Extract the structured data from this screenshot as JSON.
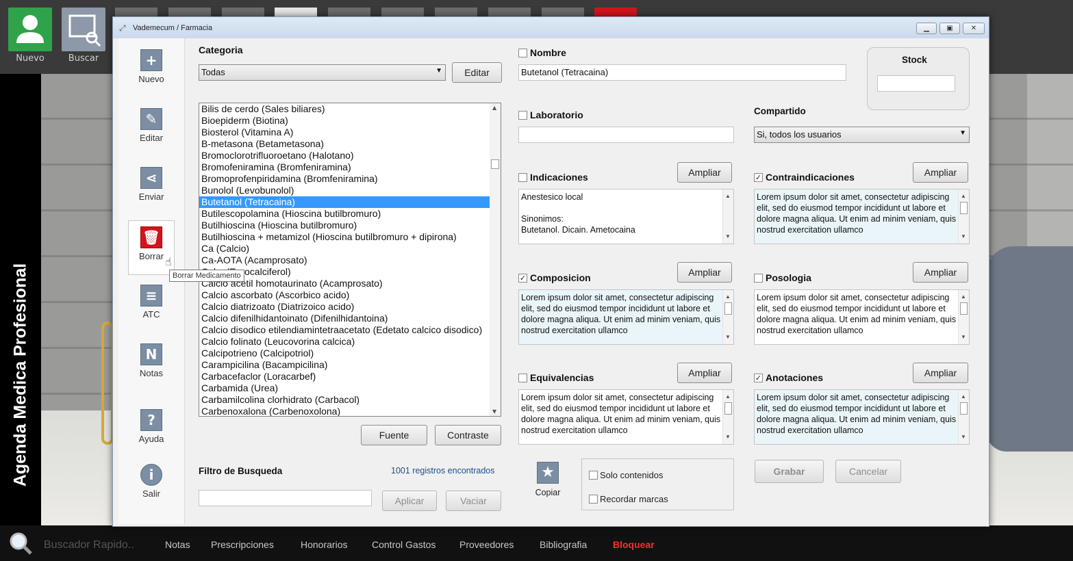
{
  "app": {
    "vertical_title": "Agenda Medica Profesional",
    "top_buttons": [
      {
        "label": "Nuevo"
      },
      {
        "label": "Buscar"
      }
    ],
    "taskbar": {
      "search_placeholder": "Buscador Rapido..",
      "links": [
        "Notas",
        "Prescripciones",
        "Honorarios",
        "Control Gastos",
        "Proveedores",
        "Bibliografia",
        "Bloquear"
      ]
    },
    "colors": {
      "accent": "#3399ff",
      "danger": "#d3141c",
      "nuevo_green": "#2fa34a",
      "bloquear_red": "#ff2b2b"
    }
  },
  "window": {
    "title": "Vademecum / Farmacia",
    "controls": [
      "minimize-icon",
      "maximize-icon",
      "close-icon"
    ]
  },
  "toolbar": {
    "items": [
      {
        "label": "Nuevo",
        "icon": "plus-icon"
      },
      {
        "label": "Editar",
        "icon": "edit-icon"
      },
      {
        "label": "Enviar",
        "icon": "share-icon"
      },
      {
        "label": "Borrar",
        "icon": "trash-icon"
      },
      {
        "label": "ATC",
        "icon": "printer-icon"
      },
      {
        "label": "Notas",
        "icon": "notes-icon"
      },
      {
        "label": "Ayuda",
        "icon": "question-icon"
      },
      {
        "label": "Salir",
        "icon": "exit-icon"
      }
    ],
    "tooltip": "Borrar Medicamento"
  },
  "categoria": {
    "label": "Categoria",
    "value": "Todas",
    "edit_label": "Editar"
  },
  "list": {
    "items": [
      "Bilis de cerdo (Sales biliares)",
      "Bioepiderm (Biotina)",
      "Biosterol (Vitamina A)",
      "B-metasona (Betametasona)",
      "Bromoclorotrifluoroetano (Halotano)",
      "Bromofeniramina (Bromfeniramina)",
      "Bromoprofenpiridamina (Bromfeniramina)",
      "Bunolol (Levobunolol)",
      "Butetanol (Tetracaina)",
      "Butilescopolamina (Hioscina butilbromuro)",
      "Butilhioscina (Hioscina butilbromuro)",
      "Butilhioscina + metamizol (Hioscina butilbromuro + dipirona)",
      "Ca (Calcio)",
      "Ca-AOTA (Acamprosato)",
      "Cal... (Ergocalciferol)",
      "Calcio acetil homotaurinato (Acamprosato)",
      "Calcio ascorbato (Ascorbico acido)",
      "Calcio diatrizoato (Diatrizoico acido)",
      "Calcio difenilhidantoinato (Difenilhidantoina)",
      "Calcio disodico etilendiamintetraacetato (Edetato calcico disodico)",
      "Calcio folinato (Leucovorina calcica)",
      "Calcipotrieno (Calcipotriol)",
      "Carampicilina (Bacampicilina)",
      "Carbacefaclor (Loracarbef)",
      "Carbamida (Urea)",
      "Carbamilcolina clorhidrato (Carbacol)",
      "Carbenoxalona (Carbenoxolona)"
    ],
    "selected_index": 8,
    "fuente_label": "Fuente",
    "contraste_label": "Contraste"
  },
  "filter": {
    "label": "Filtro de Busqueda",
    "count_text": "1001 registros encontrados",
    "value": "",
    "apply_label": "Aplicar",
    "clear_label": "Vaciar"
  },
  "form": {
    "nombre": {
      "label": "Nombre",
      "checked": false,
      "value": "Butetanol (Tetracaina)"
    },
    "stock": {
      "label": "Stock",
      "value": ""
    },
    "laboratorio": {
      "label": "Laboratorio",
      "checked": false,
      "value": ""
    },
    "compartido": {
      "label": "Compartido",
      "value": "Si, todos los usuarios"
    },
    "ampliar_label": "Ampliar",
    "lorem": "Lorem ipsum dolor sit amet, consectetur adipiscing elit, sed do eiusmod tempor incididunt ut labore et dolore magna aliqua. Ut enim ad minim veniam, quis nostrud exercitation ullamco",
    "indicaciones": {
      "label": "Indicaciones",
      "checked": false,
      "line1": "Anestesico local",
      "line2": "Sinonimos:",
      "line3": "Butetanol. Dicain. Ametocaina"
    },
    "contraindicaciones": {
      "label": "Contraindicaciones",
      "checked": true
    },
    "composicion": {
      "label": "Composicion",
      "checked": true
    },
    "posologia": {
      "label": "Posologia",
      "checked": false
    },
    "equivalencias": {
      "label": "Equivalencias",
      "checked": false
    },
    "anotaciones": {
      "label": "Anotaciones",
      "checked": true
    },
    "copiar_label": "Copiar",
    "solo_contenidos": "Solo contenidos",
    "recordar_marcas": "Recordar marcas",
    "grabar_label": "Grabar",
    "cancelar_label": "Cancelar"
  }
}
